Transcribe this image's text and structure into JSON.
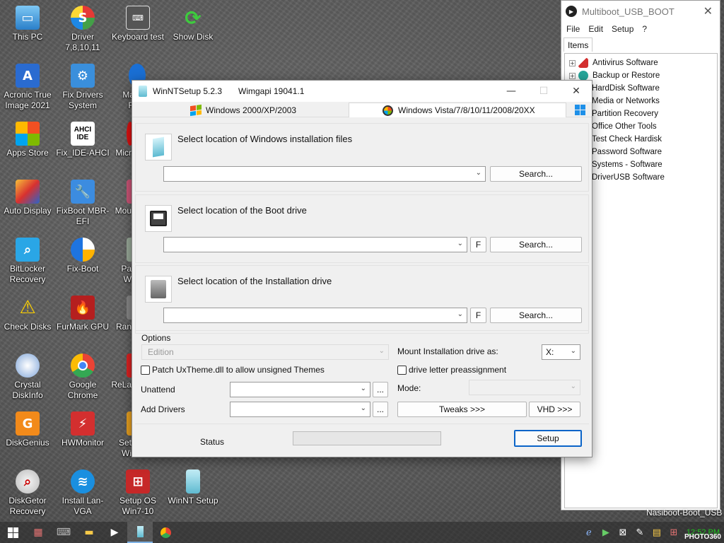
{
  "desktop": {
    "icons": [
      {
        "label": "This PC"
      },
      {
        "label": "Driver 7,8,10,11"
      },
      {
        "label": "Keyboard test"
      },
      {
        "label": "Show Disk"
      },
      {
        "label": "Acronic True Image 2021"
      },
      {
        "label": "Fix Drivers System"
      },
      {
        "label": "Apps Store"
      },
      {
        "label": "Fix_IDE-AHCI"
      },
      {
        "label": "Auto Display"
      },
      {
        "label": "FixBoot MBR-EFI"
      },
      {
        "label": "BitLocker Recovery"
      },
      {
        "label": "Fix-Boot"
      },
      {
        "label": "Check Disks"
      },
      {
        "label": "FurMark GPU"
      },
      {
        "label": "Crystal DiskInfo"
      },
      {
        "label": "Google Chrome"
      },
      {
        "label": "DiskGenius"
      },
      {
        "label": "HWMonitor"
      },
      {
        "label": "DiskGetor Recovery"
      },
      {
        "label": "Install Lan-VGA"
      },
      {
        "label": "Setup OS Win7-10"
      },
      {
        "label": "WinNT Setup"
      }
    ],
    "partial_labels": [
      "Ma",
      "R",
      "Micr",
      "Mou",
      "Pa",
      "W",
      "Ran",
      "ReLa",
      "Set",
      "Wi"
    ],
    "ahci_text": "AHCI IDE"
  },
  "multiboot": {
    "title": "Multiboot_USB_BOOT",
    "menu": [
      "File",
      "Edit",
      "Setup",
      "?"
    ],
    "tab": "Items",
    "items": [
      {
        "label": "Antivirus Software",
        "expandable": true
      },
      {
        "label": "Backup or Restore",
        "expandable": true
      },
      {
        "label": "HardDisk Software",
        "expandable": false
      },
      {
        "label": "Media or Networks",
        "expandable": false
      },
      {
        "label": "Partition Recovery",
        "expandable": false
      },
      {
        "label": "Office Other Tools",
        "expandable": false
      },
      {
        "label": "Test Check Hardisk",
        "expandable": false
      },
      {
        "label": "Password Software",
        "expandable": false
      },
      {
        "label": "Systems - Software",
        "expandable": false
      },
      {
        "label": "DriverUSB Software",
        "expandable": false
      }
    ]
  },
  "winnt": {
    "title": "WinNTSetup 5.2.3",
    "wimgapi": "Wimgapi 19041.1",
    "tabs": [
      "Windows 2000/XP/2003",
      "Windows Vista/7/8/10/11/2008/20XX"
    ],
    "sections": {
      "install_files": {
        "label": "Select location of Windows installation files",
        "value": "",
        "search": "Search..."
      },
      "boot_drive": {
        "label": "Select location of the Boot drive",
        "value": "",
        "f": "F",
        "search": "Search..."
      },
      "install_drive": {
        "label": "Select location of the Installation drive",
        "value": "",
        "f": "F",
        "search": "Search..."
      }
    },
    "options": {
      "heading": "Options",
      "edition": "Edition",
      "patch_uxtheme": "Patch UxTheme.dll to allow unsigned Themes",
      "unattend": "Unattend",
      "add_drivers": "Add Drivers",
      "ellipsis": "...",
      "mount_label": "Mount Installation drive as:",
      "mount_value": "X:",
      "drive_letter": "drive letter preassignment",
      "mode": "Mode:",
      "tweaks": "Tweaks >>>",
      "vhd": "VHD >>>"
    },
    "status": {
      "label": "Status",
      "setup": "Setup"
    }
  },
  "taskbar": {
    "clock": "12:52 PM",
    "watermark": "Nasiboot-Boot_USB",
    "photo_tag": "PHOTO360"
  }
}
